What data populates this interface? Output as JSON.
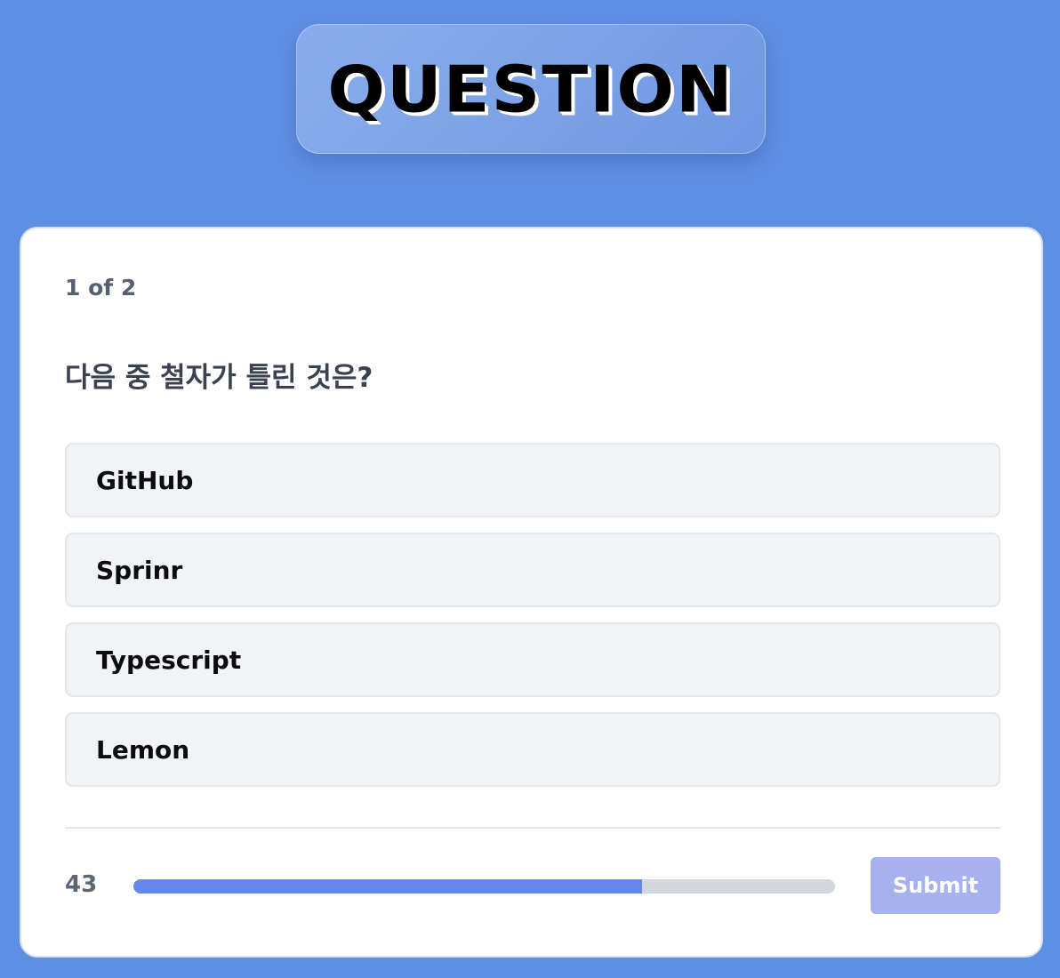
{
  "header": {
    "title": "QUESTION"
  },
  "quiz": {
    "counter": "1 of 2",
    "question": "다음 중 철자가 틀린 것은?",
    "options": [
      {
        "label": "GitHub"
      },
      {
        "label": "Sprinr"
      },
      {
        "label": "Typescript"
      },
      {
        "label": "Lemon"
      }
    ]
  },
  "footer": {
    "timer": "43",
    "progress_fraction": 0.725,
    "submit_label": "Submit"
  },
  "colors": {
    "background": "#5f8fe2",
    "progress_fill": "#6387ea",
    "progress_track": "#d3d6db",
    "submit_disabled": "#a6b1ee"
  }
}
